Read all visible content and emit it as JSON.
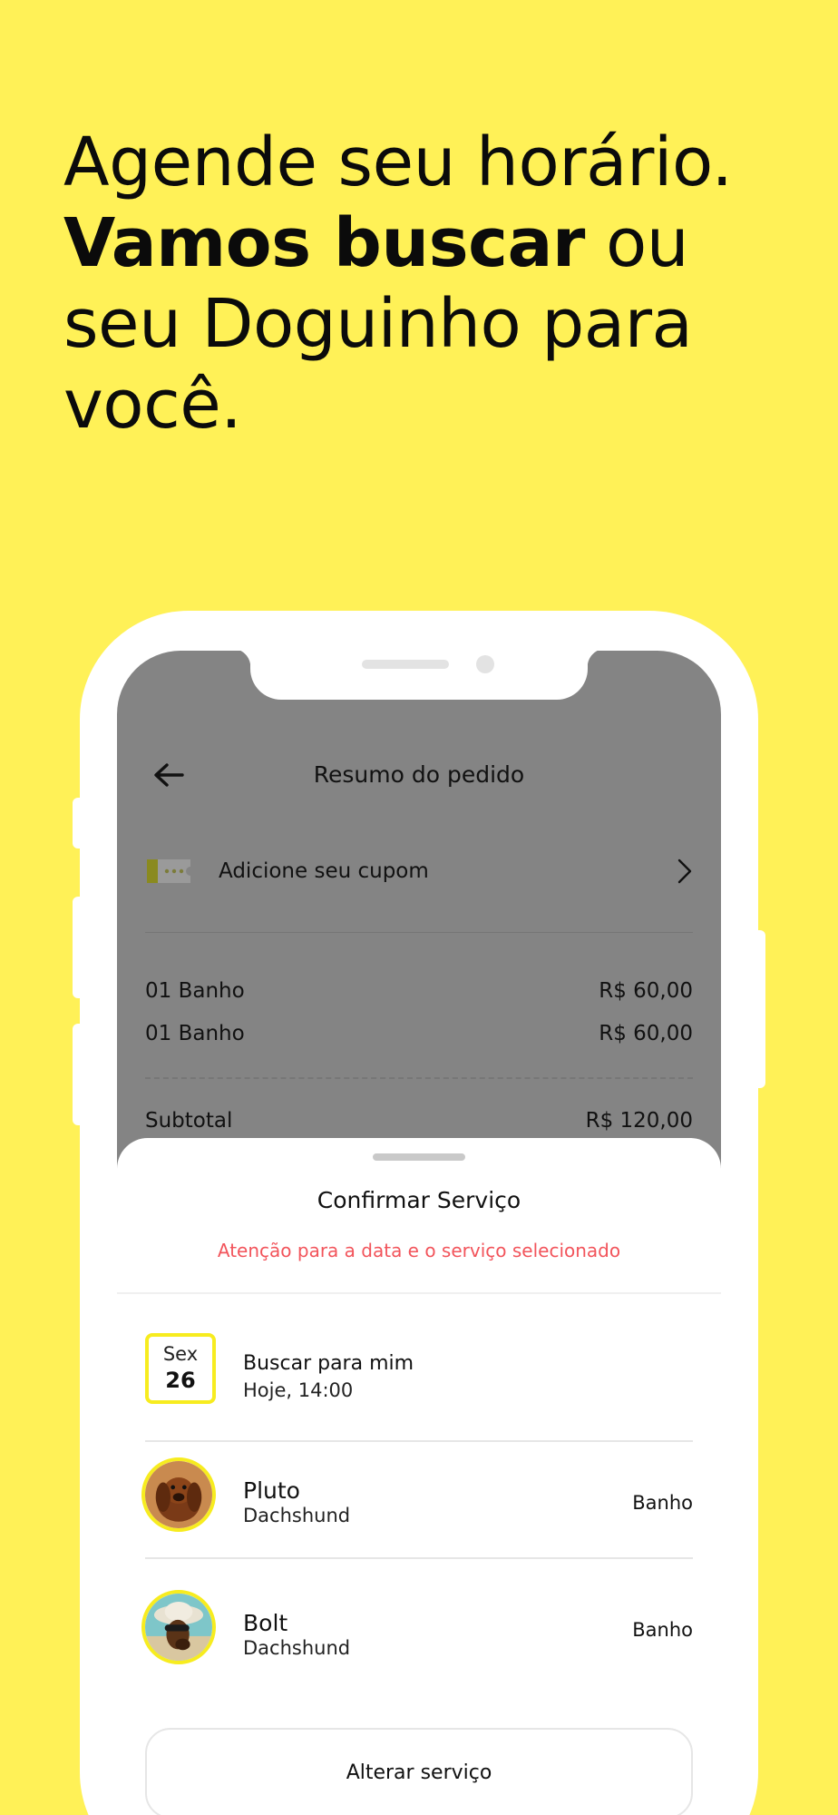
{
  "headline": {
    "line1": "Agende seu horário.",
    "bold": "Vamos buscar",
    "rest": " ou",
    "line3": "seu Doguinho para",
    "line4": "você."
  },
  "colors": {
    "background": "#FFF157",
    "accent": "#F7EC1F",
    "warning": "#F2545B",
    "overlay": "#848484"
  },
  "order": {
    "back_icon": "arrow-left-icon",
    "title": "Resumo do pedido",
    "coupon_icon": "coupon-ticket-icon",
    "coupon_label": "Adicione seu cupom",
    "coupon_chevron": "chevron-right-icon",
    "items": [
      {
        "name": "01 Banho",
        "price": "R$ 60,00"
      },
      {
        "name": "01 Banho",
        "price": "R$ 60,00"
      }
    ],
    "subtotal_label": "Subtotal",
    "subtotal_value": "R$ 120,00"
  },
  "sheet": {
    "title": "Confirmar Serviço",
    "warning": "Atenção para a data e o serviço selecionado",
    "date": {
      "weekday": "Sex",
      "day": "26"
    },
    "pickup_title": "Buscar para mim",
    "pickup_time": "Hoje, 14:00",
    "pets": [
      {
        "name": "Pluto",
        "breed": "Dachshund",
        "service": "Banho"
      },
      {
        "name": "Bolt",
        "breed": "Dachshund",
        "service": "Banho"
      }
    ],
    "alter_button": "Alterar serviço"
  }
}
